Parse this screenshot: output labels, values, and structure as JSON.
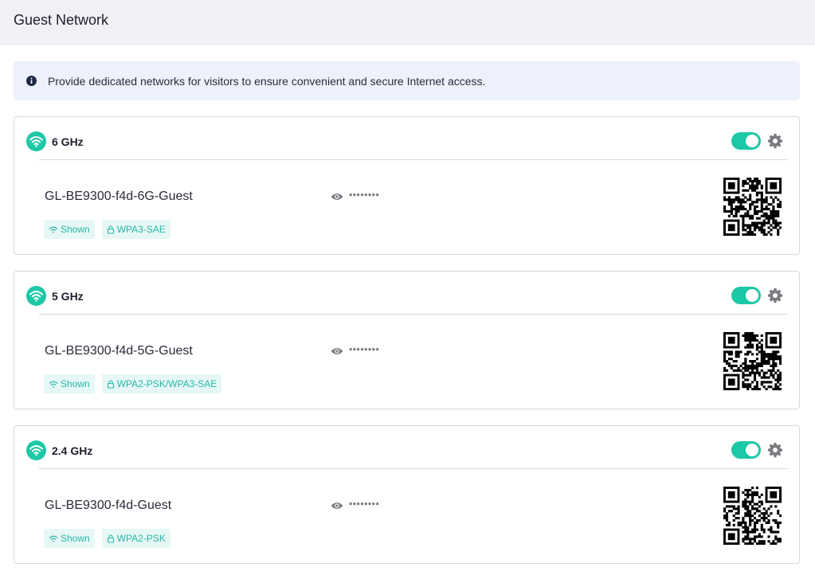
{
  "header": {
    "title": "Guest Network"
  },
  "info": {
    "text": "Provide dedicated networks for visitors to ensure convenient and secure Internet access."
  },
  "colors": {
    "accent": "#1dc8a6",
    "tag_bg": "#e6f7f6",
    "tag_text": "#26b9a6",
    "info_bg": "#edf1fb"
  },
  "networks": [
    {
      "band": "6 GHz",
      "enabled": true,
      "ssid": "GL-BE9300-f4d-6G-Guest",
      "password_masked": "********",
      "visibility": "Shown",
      "security": "WPA3-SAE",
      "icons": [
        "wifi-icon",
        "eye-icon",
        "gear-icon",
        "lock-icon",
        "qr-code"
      ]
    },
    {
      "band": "5 GHz",
      "enabled": true,
      "ssid": "GL-BE9300-f4d-5G-Guest",
      "password_masked": "********",
      "visibility": "Shown",
      "security": "WPA2-PSK/WPA3-SAE",
      "icons": [
        "wifi-icon",
        "eye-icon",
        "gear-icon",
        "lock-icon",
        "qr-code"
      ]
    },
    {
      "band": "2.4 GHz",
      "enabled": true,
      "ssid": "GL-BE9300-f4d-Guest",
      "password_masked": "********",
      "visibility": "Shown",
      "security": "WPA2-PSK",
      "icons": [
        "wifi-icon",
        "eye-icon",
        "gear-icon",
        "lock-icon",
        "qr-code"
      ]
    }
  ]
}
